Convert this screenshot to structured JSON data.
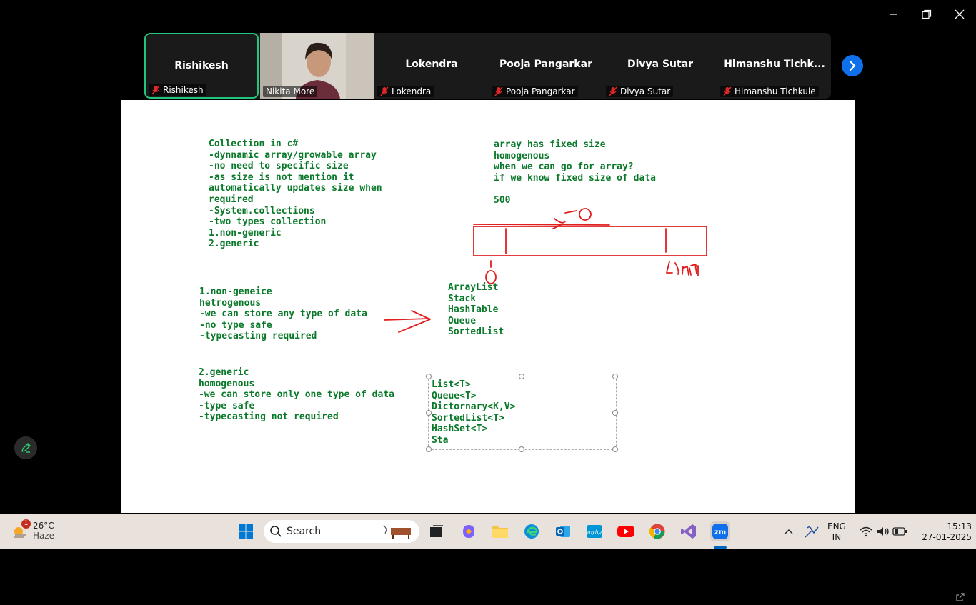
{
  "participants": [
    {
      "name": "Rishikesh",
      "label": "Rishikesh",
      "muted": true,
      "video": false,
      "active": true
    },
    {
      "name": "",
      "label": "Nikita More",
      "muted": false,
      "video": true,
      "active": false
    },
    {
      "name": "Lokendra",
      "label": "Lokendra",
      "muted": true,
      "video": false,
      "active": false
    },
    {
      "name": "Pooja Pangarkar",
      "label": "Pooja Pangarkar",
      "muted": true,
      "video": false,
      "active": false
    },
    {
      "name": "Divya Sutar",
      "label": "Divya Sutar",
      "muted": true,
      "video": false,
      "active": false
    },
    {
      "name": "Himanshu  Tichk...",
      "label": "Himanshu Tichkule",
      "muted": true,
      "video": false,
      "active": false
    }
  ],
  "board": {
    "block1": [
      "Collection in c#",
      "-dynnamic array/growable array",
      "-no need to specific size",
      "-as size is not mention it",
      "automatically updates size when",
      "required",
      "-System.collections",
      "-two types collection",
      "1.non-generic",
      "2.generic"
    ],
    "block2": [
      "array has fixed size",
      "homogenous",
      "when we can go for array?",
      "if we know fixed size of data",
      "",
      "500"
    ],
    "block3": [
      "1.non-geneice",
      "hetrogenous",
      "-we can store any type of data",
      "-no type safe",
      "-typecasting required"
    ],
    "block4": [
      "ArrayList",
      "Stack",
      "HashTable",
      "Queue",
      "SortedList"
    ],
    "block5": [
      "2.generic",
      "homogenous",
      "-we can store only one type of data",
      "-type safe",
      "-typecasting not required"
    ],
    "block6": [
      "List<T>",
      "Queue<T>",
      "Dictornary<K,V>",
      "SortedList<T>",
      "HashSet<T>",
      "Sta"
    ]
  },
  "taskbar": {
    "weather_temp": "26°C",
    "weather_cond": "Haze",
    "weather_badge": "1",
    "search_label": "Search",
    "lang_top": "ENG",
    "lang_bottom": "IN",
    "time": "15:13",
    "date": "27-01-2025"
  },
  "colors": {
    "board_text": "#0a7a2a",
    "ink": "#e02020",
    "active_border": "#23c47e",
    "zoom_blue": "#0e71eb"
  }
}
